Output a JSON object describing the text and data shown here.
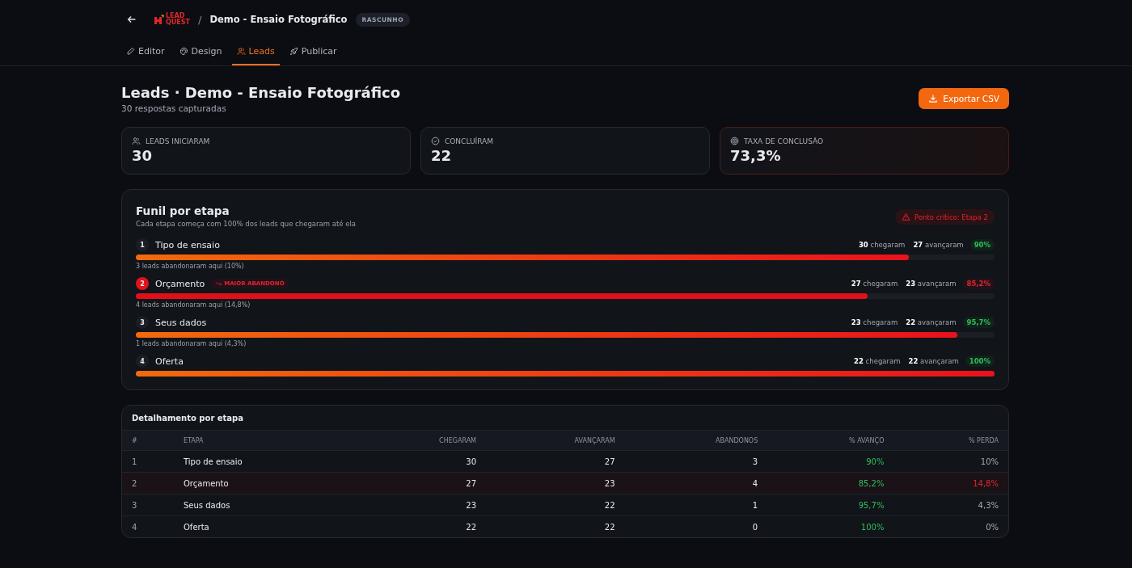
{
  "header": {
    "logo_text": "LEAD QUEST",
    "title": "Demo - Ensaio Fotográfico",
    "separator": "/",
    "status_badge": "RASCUNHO"
  },
  "tabs": [
    {
      "label": "Editor",
      "selected": false
    },
    {
      "label": "Design",
      "selected": false
    },
    {
      "label": "Leads",
      "selected": true
    },
    {
      "label": "Publicar",
      "selected": false
    }
  ],
  "page": {
    "title": "Leads · Demo - Ensaio Fotográfico",
    "subtitle": "30 respostas capturadas",
    "export_button": "Exportar CSV"
  },
  "stats": [
    {
      "label": "LEADS INICIARAM",
      "value": "30",
      "highlight": false
    },
    {
      "label": "CONCLUÍRAM",
      "value": "22",
      "highlight": false
    },
    {
      "label": "TAXA DE CONCLUSÃO",
      "value": "73,3%",
      "highlight": true
    }
  ],
  "funnel": {
    "title": "Funil por etapa",
    "subtitle": "Cada etapa começa com 100% dos leads que chegaram até ela",
    "critical_badge": "Ponto crítico: Etapa 2",
    "stages": [
      {
        "number": "1",
        "name": "Tipo de ensaio",
        "critical": false,
        "arrived": "30",
        "arrived_label": "chegaram",
        "advanced": "27",
        "advanced_label": "avançaram",
        "rate": "90%",
        "level": 0.9,
        "dropout_note": "3 leads abandonaram aqui (10%)"
      },
      {
        "number": "2",
        "name": "Orçamento",
        "critical": true,
        "badge": "MAIOR ABANDONO",
        "arrived": "27",
        "arrived_label": "chegaram",
        "advanced": "23",
        "advanced_label": "avançaram",
        "rate": "85,2%",
        "level": 0.852,
        "dropout_note": "4 leads abandonaram aqui (14,8%)"
      },
      {
        "number": "3",
        "name": "Seus dados",
        "critical": false,
        "arrived": "23",
        "arrived_label": "chegaram",
        "advanced": "22",
        "advanced_label": "avançaram",
        "rate": "95,7%",
        "level": 0.957,
        "dropout_note": "1 leads abandonaram aqui (4,3%)"
      },
      {
        "number": "4",
        "name": "Oferta",
        "critical": false,
        "arrived": "22",
        "arrived_label": "chegaram",
        "advanced": "22",
        "advanced_label": "avançaram",
        "rate": "100%",
        "level": 1
      }
    ]
  },
  "table": {
    "title": "Detalhamento por etapa",
    "columns": [
      "#",
      "ETAPA",
      "CHEGARAM",
      "AVANÇARAM",
      "ABANDONOS",
      "% AVANÇO",
      "% PERDA"
    ],
    "rows": [
      {
        "critical": false,
        "cells": [
          "1",
          "Tipo de ensaio",
          "30",
          "27",
          "3",
          "90%",
          "10%"
        ]
      },
      {
        "critical": true,
        "cells": [
          "2",
          "Orçamento",
          "27",
          "23",
          "4",
          "85,2%",
          "14,8%"
        ]
      },
      {
        "critical": false,
        "cells": [
          "3",
          "Seus dados",
          "23",
          "22",
          "1",
          "95,7%",
          "4,3%"
        ]
      },
      {
        "critical": false,
        "cells": [
          "4",
          "Oferta",
          "22",
          "22",
          "0",
          "100%",
          "0%"
        ]
      }
    ]
  }
}
